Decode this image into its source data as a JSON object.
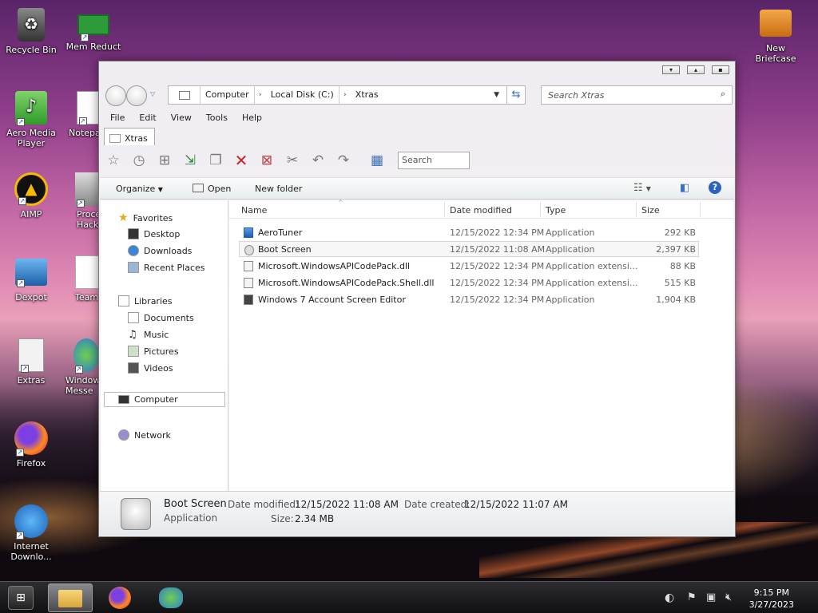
{
  "desktop": {
    "icons": [
      {
        "label": "Recycle Bin"
      },
      {
        "label": "Mem Reduct"
      },
      {
        "label": "New Briefcase"
      },
      {
        "label": "Aero Media Player"
      },
      {
        "label": "Notepa"
      },
      {
        "label": "AIMP"
      },
      {
        "label": "Proce Hacke"
      },
      {
        "label": "Dexpot"
      },
      {
        "label": "Team"
      },
      {
        "label": "Extras"
      },
      {
        "label": "Window Messe"
      },
      {
        "label": "Firefox"
      },
      {
        "label": "Internet Downlo..."
      }
    ]
  },
  "window": {
    "title_buttons": [
      "▾",
      "▴",
      "▪"
    ],
    "address": {
      "crumbs": [
        "Computer",
        "Local Disk (C:)",
        "Xtras"
      ],
      "search_placeholder": "Search Xtras"
    },
    "menu": [
      "File",
      "Edit",
      "View",
      "Tools",
      "Help"
    ],
    "tab": {
      "label": "Xtras"
    },
    "toolbar": {
      "search_placeholder": "Search"
    },
    "commands": {
      "organize": "Organize",
      "open": "Open",
      "new_folder": "New folder"
    },
    "nav": {
      "favorites": "Favorites",
      "desktop": "Desktop",
      "downloads": "Downloads",
      "recent": "Recent Places",
      "libraries": "Libraries",
      "documents": "Documents",
      "music": "Music",
      "pictures": "Pictures",
      "videos": "Videos",
      "computer": "Computer",
      "network": "Network"
    },
    "columns": {
      "name": "Name",
      "date": "Date modified",
      "type": "Type",
      "size": "Size"
    },
    "files": [
      {
        "name": "AeroTuner",
        "date": "12/15/2022 12:34 PM",
        "type": "Application",
        "size": "292 KB"
      },
      {
        "name": "Boot Screen",
        "date": "12/15/2022 11:08 AM",
        "type": "Application",
        "size": "2,397 KB"
      },
      {
        "name": "Microsoft.WindowsAPICodePack.dll",
        "date": "12/15/2022 12:34 PM",
        "type": "Application extensi...",
        "size": "88 KB"
      },
      {
        "name": "Microsoft.WindowsAPICodePack.Shell.dll",
        "date": "12/15/2022 12:34 PM",
        "type": "Application extensi...",
        "size": "515 KB"
      },
      {
        "name": "Windows 7 Account Screen Editor",
        "date": "12/15/2022 12:34 PM",
        "type": "Application",
        "size": "1,904 KB"
      }
    ],
    "details": {
      "name": "Boot Screen",
      "kind": "Application",
      "date_modified_label": "Date modified:",
      "date_modified": "12/15/2022 11:08 AM",
      "date_created_label": "Date created:",
      "date_created": "12/15/2022 11:07 AM",
      "size_label": "Size:",
      "size": "2.34 MB"
    }
  },
  "taskbar": {
    "time": "9:15 PM",
    "date": "3/27/2023"
  },
  "colors": {
    "accent": "#3a6fbf",
    "window_bg": "#f4f4f6",
    "selection": "#f7f7f7"
  }
}
